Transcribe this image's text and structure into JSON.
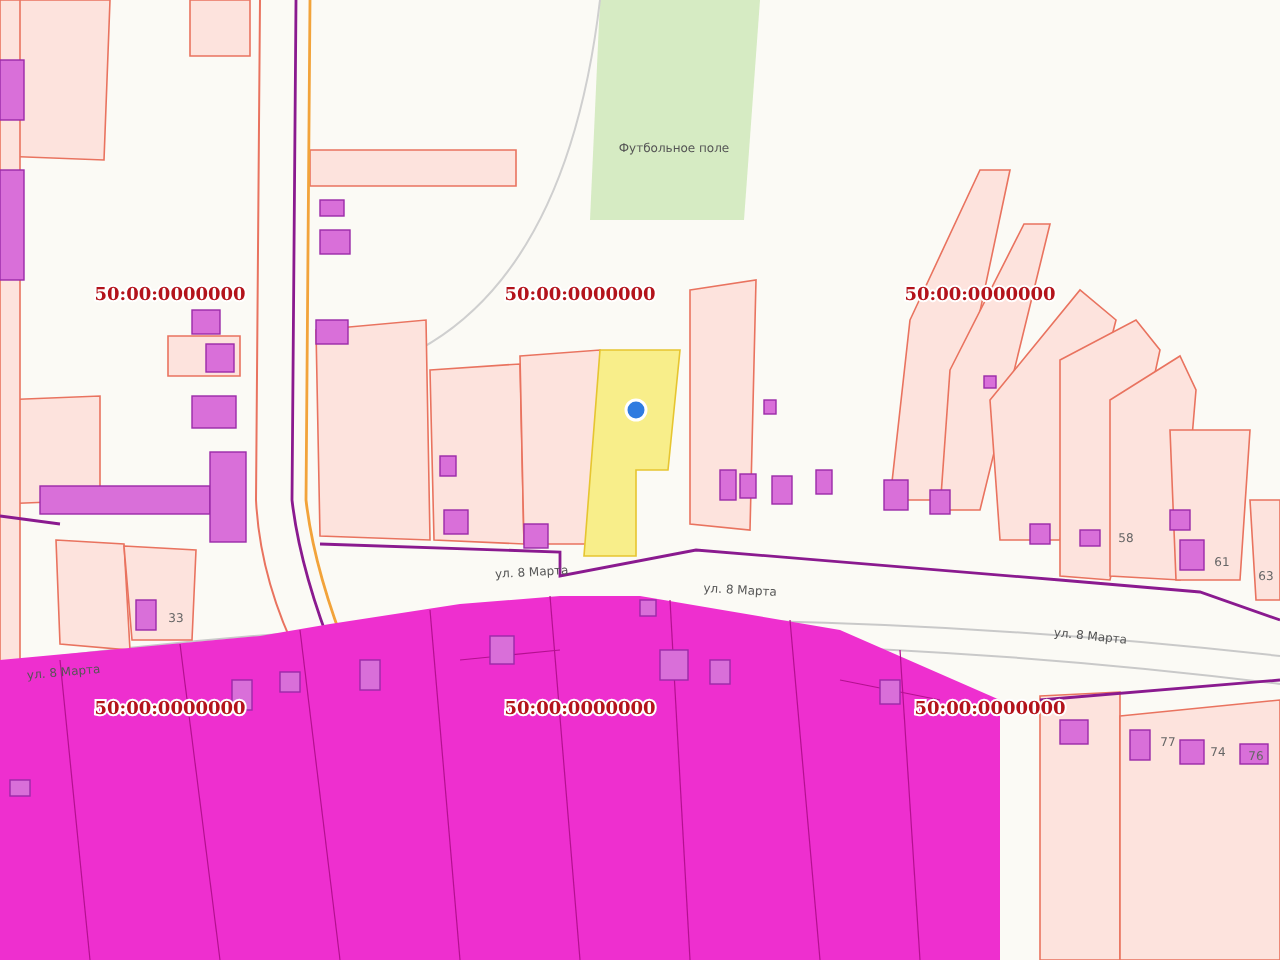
{
  "map": {
    "cadastral_labels": [
      "50:00:0000000",
      "50:00:0000000",
      "50:00:0000000",
      "50:00:0000000",
      "50:00:0000000",
      "50:00:0000000"
    ],
    "street_labels": [
      "ул. 8 Марта",
      "ул. 8 Марта",
      "ул. 8 Марта",
      "ул. 8 Марта"
    ],
    "place_labels": [
      "Футбольное поле"
    ],
    "house_numbers": [
      "33",
      "58",
      "61",
      "63",
      "77",
      "74",
      "76"
    ]
  }
}
